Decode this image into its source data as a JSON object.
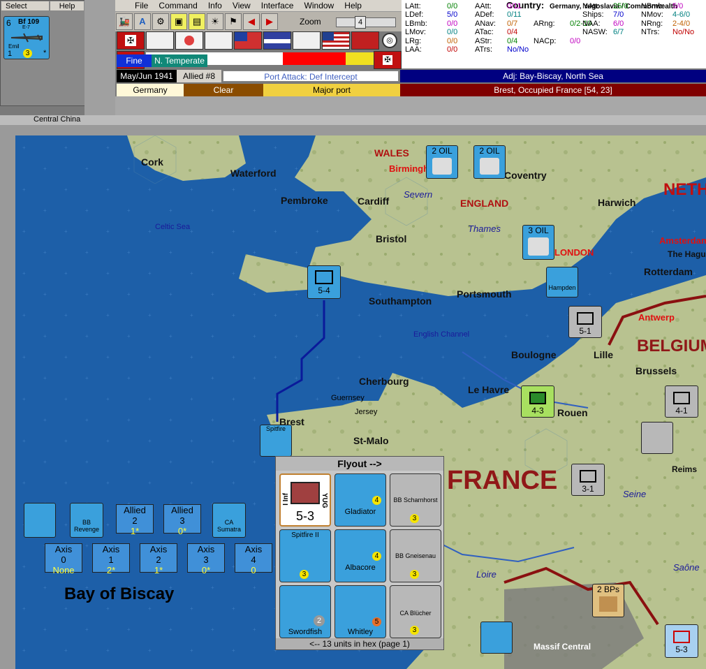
{
  "left_panel": {
    "select_label": "Select",
    "help_label": "Help",
    "unit": {
      "name": "Bf 109",
      "model": "E-7",
      "pilot": "Emil",
      "top": "6",
      "bottom_left": "1",
      "bottom_mid": "3",
      "mark": "*"
    }
  },
  "menu": [
    "File",
    "Command",
    "Info",
    "View",
    "Interface",
    "Window",
    "Help"
  ],
  "toolbar": {
    "zoom_label": "Zoom",
    "zoom_value": "4"
  },
  "weather": {
    "weather": "Fine",
    "zone": "N. Temperate"
  },
  "turn": {
    "date": "May/Jun 1941",
    "impulse": "Allied #8",
    "phase": "Port Attack: Def Intercept"
  },
  "hexinfo": {
    "country": "Germany",
    "terrain": "Clear",
    "port": "Major port",
    "adjacent": "Adj: Bay-Biscay, North Sea",
    "location": "Brest, Occupied France [54, 23]"
  },
  "stats": {
    "country_label": "Country:",
    "country_value": "Germany, Yugoslavia / Commonwealth",
    "rows": [
      [
        "LAtt:",
        "0/0",
        "AAtt:",
        "0/11",
        "",
        "",
        "NAtt:",
        "25/0",
        "NBmb:",
        "5/0"
      ],
      [
        "LDef:",
        "5/0",
        "ADef:",
        "0/11",
        "",
        "",
        "Ships:",
        "7/0",
        "NMov:",
        "4-6/0"
      ],
      [
        "LBmb:",
        "0/0",
        "ANav:",
        "0/7",
        "ARng:",
        "0/2-10",
        "NAA:",
        "6/0",
        "NRng:",
        "2-4/0"
      ],
      [
        "LMov:",
        "0/0",
        "ATac:",
        "0/4",
        "",
        "",
        "NASW:",
        "6/7",
        "NTrs:",
        "No/No"
      ],
      [
        "LRg:",
        "0/0",
        "AStr:",
        "0/4",
        "NACp:",
        "0/0",
        "",
        "",
        "",
        ""
      ],
      [
        "LAA:",
        "0/0",
        "ATrs:",
        "No/No",
        "",
        "",
        "",
        "",
        "",
        ""
      ]
    ]
  },
  "map": {
    "tab_title": "Central China",
    "cities": [
      "Cork",
      "Waterford",
      "Pembroke",
      "Cardiff",
      "Bristol",
      "Southampton",
      "Portsmouth",
      "Boulogne",
      "Lille",
      "Brussels",
      "Cherbourg",
      "Le Havre",
      "St-Malo",
      "Brest",
      "Rotterdam",
      "Harwich",
      "Coventry",
      "The Hague",
      "Reims",
      "Rouen"
    ],
    "regions": [
      "WALES",
      "ENGLAND",
      "FRANCE",
      "BELGIUM",
      "NETH",
      "LONDON",
      "Birmingham",
      "Amsterdam",
      "Antwerp"
    ],
    "seas": [
      "Celtic Sea",
      "English Channel",
      "Bay of Biscay",
      "Severn",
      "Thames",
      "Seine",
      "Loire",
      "Saône",
      "Guernsey",
      "Jersey",
      "Massif Central"
    ],
    "oil": [
      "2 OIL",
      "2 OIL",
      "3 OIL"
    ],
    "bps": "2 BPs"
  },
  "sea_boxes": {
    "allied": [
      {
        "title": "Allied",
        "num": "2",
        "val": "1*"
      },
      {
        "title": "Allied",
        "num": "3",
        "val": "0*"
      }
    ],
    "axis": [
      {
        "title": "Axis",
        "num": "0",
        "val": "None"
      },
      {
        "title": "Axis",
        "num": "1",
        "val": "2*"
      },
      {
        "title": "Axis",
        "num": "2",
        "val": "1*"
      },
      {
        "title": "Axis",
        "num": "3",
        "val": "0*"
      },
      {
        "title": "Axis",
        "num": "4",
        "val": "0"
      }
    ]
  },
  "flyout": {
    "title": "Flyout -->",
    "footer": "<-- 13 units in hex (page 1)",
    "units": [
      {
        "name": "I Inf",
        "value": "5-3",
        "tag": "YUG"
      },
      {
        "name": "Gladiator",
        "value": "4"
      },
      {
        "name": "BB Scharnhorst",
        "value": "3"
      },
      {
        "name": "Spitfire II",
        "value": "3"
      },
      {
        "name": "Albacore",
        "value": "4"
      },
      {
        "name": "BB Gneisenau",
        "value": "3"
      },
      {
        "name": "Swordfish",
        "value": "2"
      },
      {
        "name": "Whitley",
        "value": "5"
      },
      {
        "name": "CA Blücher",
        "value": "3"
      }
    ]
  },
  "map_counters": [
    "5-4",
    "5-1",
    "4-3",
    "4-1",
    "3-1",
    "5-3",
    "Hampden",
    "Spitfire",
    "BB Revenge",
    "CA Sumatra"
  ]
}
